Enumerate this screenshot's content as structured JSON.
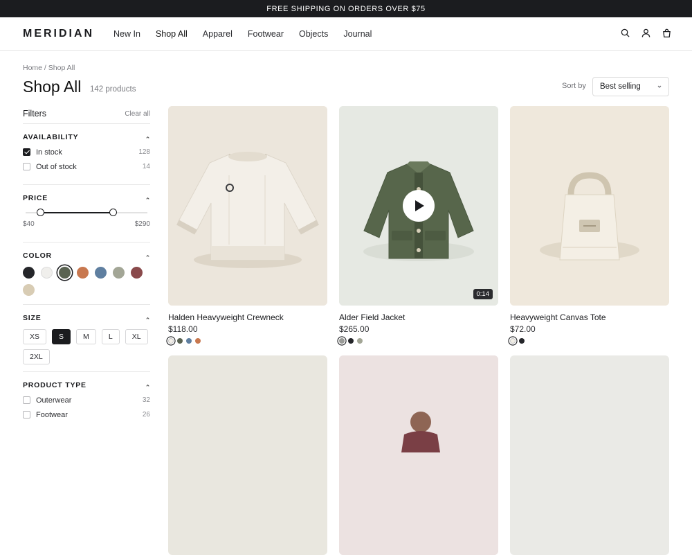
{
  "announcement": "FREE SHIPPING ON ORDERS OVER $75",
  "brand": "MERIDIAN",
  "nav": [
    "New In",
    "Shop All",
    "Apparel",
    "Footwear",
    "Objects",
    "Journal"
  ],
  "breadcrumb": "Home / Shop All",
  "page_title": "Shop All",
  "product_count": "142 products",
  "sort": {
    "label": "Sort by",
    "value": "Best selling"
  },
  "filters": {
    "title": "Filters",
    "clear": "Clear all",
    "availability": {
      "title": "AVAILABILITY",
      "options": [
        {
          "label": "In stock",
          "count": "128",
          "checked": true
        },
        {
          "label": "Out of stock",
          "count": "14",
          "checked": false
        }
      ]
    },
    "price": {
      "title": "PRICE",
      "min": "$40",
      "max": "$290",
      "range_low_fraction": 0.12,
      "range_high_fraction": 0.72
    },
    "color": {
      "title": "COLOR",
      "swatches": [
        "#25262a",
        "#f0efec",
        "#5a6352",
        "#c8784f",
        "#5f7fa0",
        "#a3a696",
        "#8a4a4c",
        "#d8ccb4"
      ],
      "selected_index": 2
    },
    "size": {
      "title": "SIZE",
      "options": [
        "XS",
        "S",
        "M",
        "L",
        "XL",
        "2XL"
      ],
      "selected": "S"
    },
    "product_type": {
      "title": "PRODUCT TYPE",
      "options": [
        {
          "label": "Outerwear",
          "count": "32",
          "checked": false
        },
        {
          "label": "Footwear",
          "count": "26",
          "checked": false
        }
      ]
    }
  },
  "products": [
    {
      "name": "Halden Heavyweight Crewneck",
      "price": "$118.00",
      "colors": [
        "#f3efe8",
        "#5a6352",
        "#5f7fa0",
        "#c8784f"
      ],
      "selected_color": 0
    },
    {
      "name": "Alder Field Jacket",
      "price": "$265.00",
      "colors": [
        "#9a9b98",
        "#25262a",
        "#a3a696"
      ],
      "selected_color": 0,
      "video_duration": "0:14"
    },
    {
      "name": "Heavyweight Canvas Tote",
      "price": "$72.00",
      "colors": [
        "#f0ede5",
        "#25262a"
      ],
      "selected_color": 0
    }
  ],
  "colors": {
    "accent": "#1b1c1f",
    "muted_text": "#7a7b80",
    "border": "#e7e7e7"
  }
}
